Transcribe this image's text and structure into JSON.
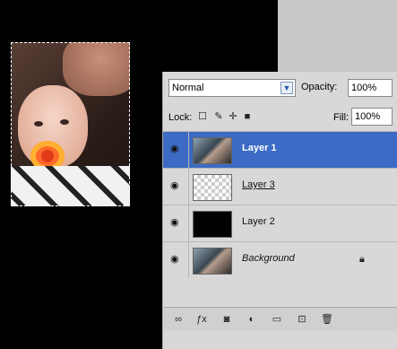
{
  "canvas": {},
  "layers_panel": {
    "blend_mode": "Normal",
    "opacity_label": "Opacity:",
    "opacity_value": "100%",
    "lock_label": "Lock:",
    "fill_label": "Fill:",
    "fill_value": "100%",
    "layers": [
      {
        "name": "Layer 1",
        "selected": true
      },
      {
        "name": "Layer 3",
        "selected": false
      },
      {
        "name": "Layer 2",
        "selected": false
      },
      {
        "name": "Background",
        "selected": false
      }
    ]
  },
  "colors": {
    "selected_row": "#3b6bc4",
    "panel_bg": "#d8d8d8"
  }
}
